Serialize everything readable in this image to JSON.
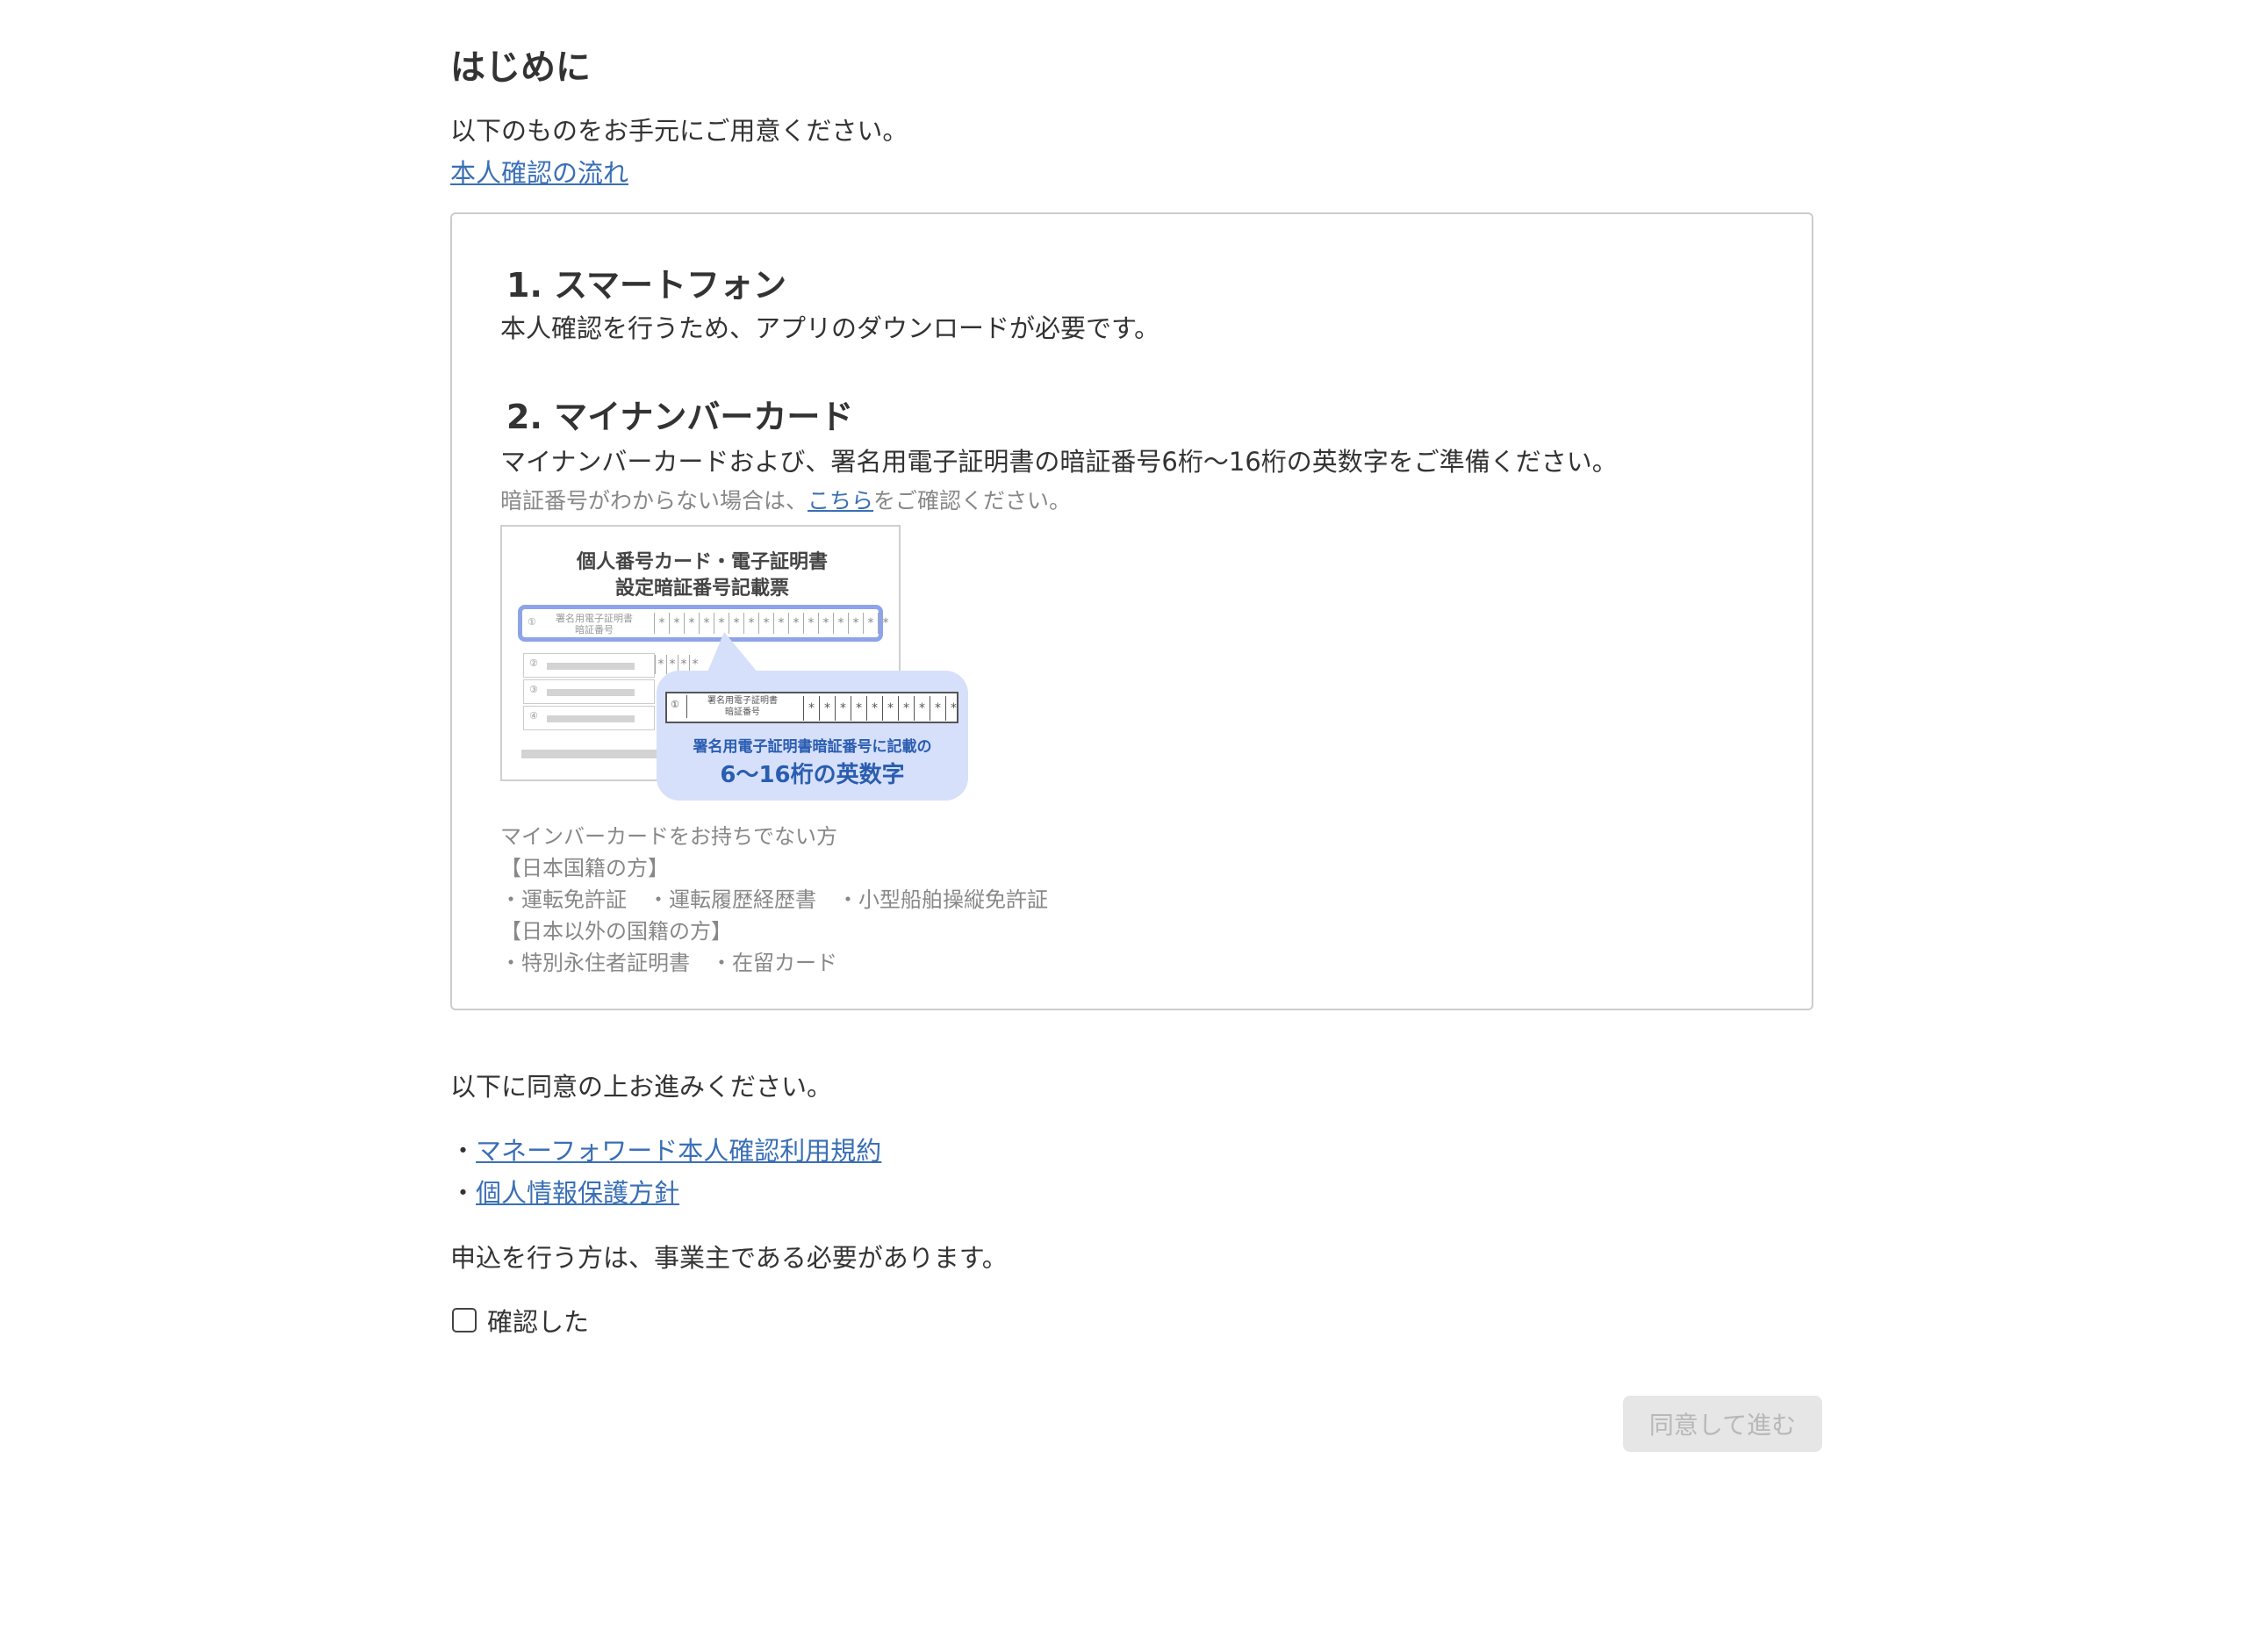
{
  "header": {
    "title": "はじめに",
    "intro": "以下のものをお手元にご用意ください。",
    "flow_link": "本人確認の流れ"
  },
  "card": {
    "step1": {
      "heading": "1. スマートフォン",
      "text": "本人確認を行うため、アプリのダウンロードが必要です。"
    },
    "step2": {
      "heading": "2. マイナンバーカード",
      "text": "マイナンバーカードおよび、署名用電子証明書の暗証番号6桁〜16桁の英数字をご準備ください。",
      "note_prefix": "暗証番号がわからない場合は、",
      "note_link": "こちら",
      "note_suffix": "をご確認ください。"
    },
    "illustration": {
      "title_line1": "個人番号カード・電子証明書",
      "title_line2": "設定暗証番号記載票",
      "row_label_line1": "署名用電子証明書",
      "row_label_line2": "暗証番号",
      "row_number": "①",
      "star": "*",
      "bubble_caption_line1": "署名用電子証明書暗証番号に記載の",
      "bubble_caption_line2": "6〜16桁の英数字",
      "small_row_numbers": [
        "②",
        "③",
        "④"
      ]
    },
    "no_card": {
      "heading": "マインバーカードをお持ちでない方",
      "japanese_heading": "【日本国籍の方】",
      "japanese_items": "・運転免許証　・運転履歴経歴書　・小型船舶操縦免許証",
      "foreign_heading": "【日本以外の国籍の方】",
      "foreign_items": "・特別永住者証明書　・在留カード"
    }
  },
  "agreement": {
    "lead": "以下に同意の上お進みください。",
    "bullet": "・",
    "terms": [
      {
        "label": "マネーフォワード本人確認利用規約"
      },
      {
        "label": "個人情報保護方針"
      }
    ],
    "owner_note": "申込を行う方は、事業主である必要があります。",
    "checkbox_label": "確認した",
    "checkbox_checked": false,
    "proceed_button": "同意して進む",
    "proceed_enabled": false
  },
  "colors": {
    "link": "#3a6fb5",
    "bubble": "#d6e0fb",
    "highlight_border": "#8ea4e8",
    "disabled_button_bg": "#e6e6e6",
    "disabled_button_text": "#b8b8b8"
  }
}
